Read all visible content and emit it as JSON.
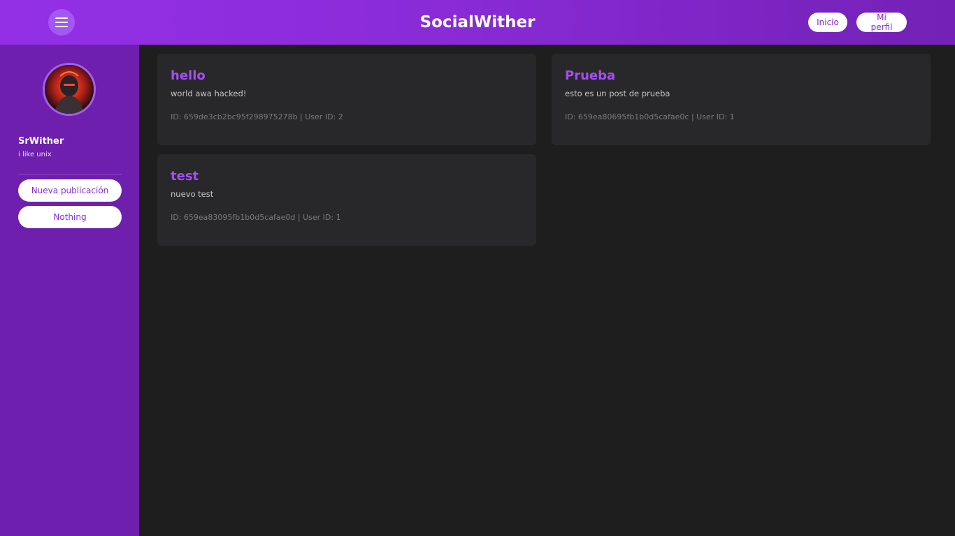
{
  "header": {
    "title": "SocialWither",
    "menu_icon": "hamburger-menu-icon",
    "nav": {
      "home_label": "Inicio",
      "profile_label": "Mi perfil"
    }
  },
  "sidebar": {
    "user": {
      "name": "SrWither",
      "bio": "i like unix"
    },
    "buttons": {
      "new_post_label": "Nueva publicación",
      "nothing_label": "Nothing"
    }
  },
  "posts": [
    {
      "title": "hello",
      "body": "world awa hacked!",
      "meta": "ID: 659de3cb2bc95f298975278b  |  User ID: 2"
    },
    {
      "title": "Prueba",
      "body": "esto es un post de prueba",
      "meta": "ID: 659ea80695fb1b0d5cafae0c  |  User ID: 1"
    },
    {
      "title": "test",
      "body": "nuevo test",
      "meta": "ID: 659ea83095fb1b0d5cafae0d  |  User ID: 1"
    }
  ],
  "colors": {
    "accent": "#9330e6",
    "sidebar": "#6e1fae",
    "background": "#1e1e1f",
    "card": "#28282a",
    "post_title": "#a64ff0"
  }
}
